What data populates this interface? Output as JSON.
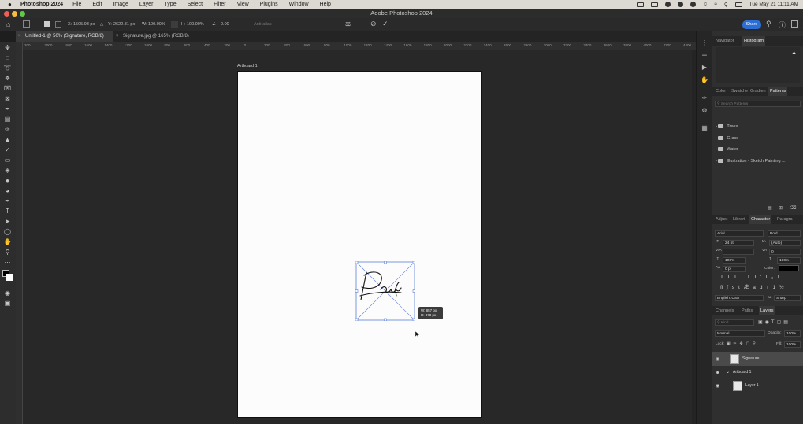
{
  "menubar": {
    "app_name": "Photoshop 2024",
    "items": [
      "File",
      "Edit",
      "Image",
      "Layer",
      "Type",
      "Select",
      "Filter",
      "View",
      "Plugins",
      "Window",
      "Help"
    ],
    "datetime": "Tue May 21  11:11 AM"
  },
  "window": {
    "title": "Adobe Photoshop 2024",
    "traffic_colors": [
      "#ee5f58",
      "#f8bd40",
      "#5fc948"
    ]
  },
  "options": {
    "x_label": "X:",
    "x_value": "1505.93 px",
    "y_label": "Y:",
    "y_value": "2622.81 px",
    "w_label": "W:",
    "w_value": "100.00%",
    "h_label": "H:",
    "h_value": "100.00%",
    "angle_value": "0.00",
    "interp_label": "Anti-alias",
    "share_label": "Share"
  },
  "tabs": [
    {
      "label": "Untitled-1 @ 50% (Signature, RGB/8)"
    },
    {
      "label": "Signature.jpg @ 165% (RGB/8)"
    }
  ],
  "ruler": {
    "ticks": [
      "200",
      "2000",
      "1800",
      "1600",
      "1400",
      "1200",
      "1000",
      "800",
      "600",
      "400",
      "200",
      "0",
      "200",
      "400",
      "600",
      "800",
      "1000",
      "1200",
      "1400",
      "1600",
      "1800",
      "2000",
      "2200",
      "2400",
      "2600",
      "2800",
      "3000",
      "3200",
      "3400",
      "3600",
      "3800",
      "4000",
      "4200",
      "4400"
    ]
  },
  "canvas": {
    "artboard_label": "Artboard 1",
    "signature_text": "Pau",
    "measure_w": "W: 857 px",
    "measure_h": "H: 878 px"
  },
  "panels": {
    "nav_tabs": [
      "Navigator",
      "Histogram"
    ],
    "nav_active": "Histogram",
    "color_tabs": [
      "Color",
      "Swatche",
      "Gradien",
      "Patterns"
    ],
    "color_active": "Patterns",
    "search_placeholder": "Search Patterns",
    "pattern_groups": [
      "Trees",
      "Grass",
      "Water",
      "Illustration - Sketch Painting ..."
    ],
    "char_tabs": [
      "Adjust",
      "Librari",
      "Character",
      "Paragra"
    ],
    "char_active": "Character",
    "font_family": "Arial",
    "font_style": "Bold",
    "font_size": "24 pt",
    "leading": "(Auto)",
    "va": "",
    "tracking": "0",
    "vscale": "100%",
    "hscale": "100%",
    "baseline": "0 pt",
    "color_label": "Color:",
    "text_color": "#000000",
    "language": "English: USA",
    "antialias": "Sharp",
    "layers_tabs": [
      "Channels",
      "Paths",
      "Layers"
    ],
    "layers_active": "Layers",
    "kind_placeholder": "Kind",
    "blend_mode": "Normal",
    "opacity_label": "Opacity:",
    "opacity_value": "100%",
    "lock_label": "Lock:",
    "fill_label": "Fill:",
    "fill_value": "100%",
    "layers": [
      {
        "name": "Signature"
      },
      {
        "name": "Artboard 1"
      },
      {
        "name": "Layer 1"
      }
    ]
  }
}
